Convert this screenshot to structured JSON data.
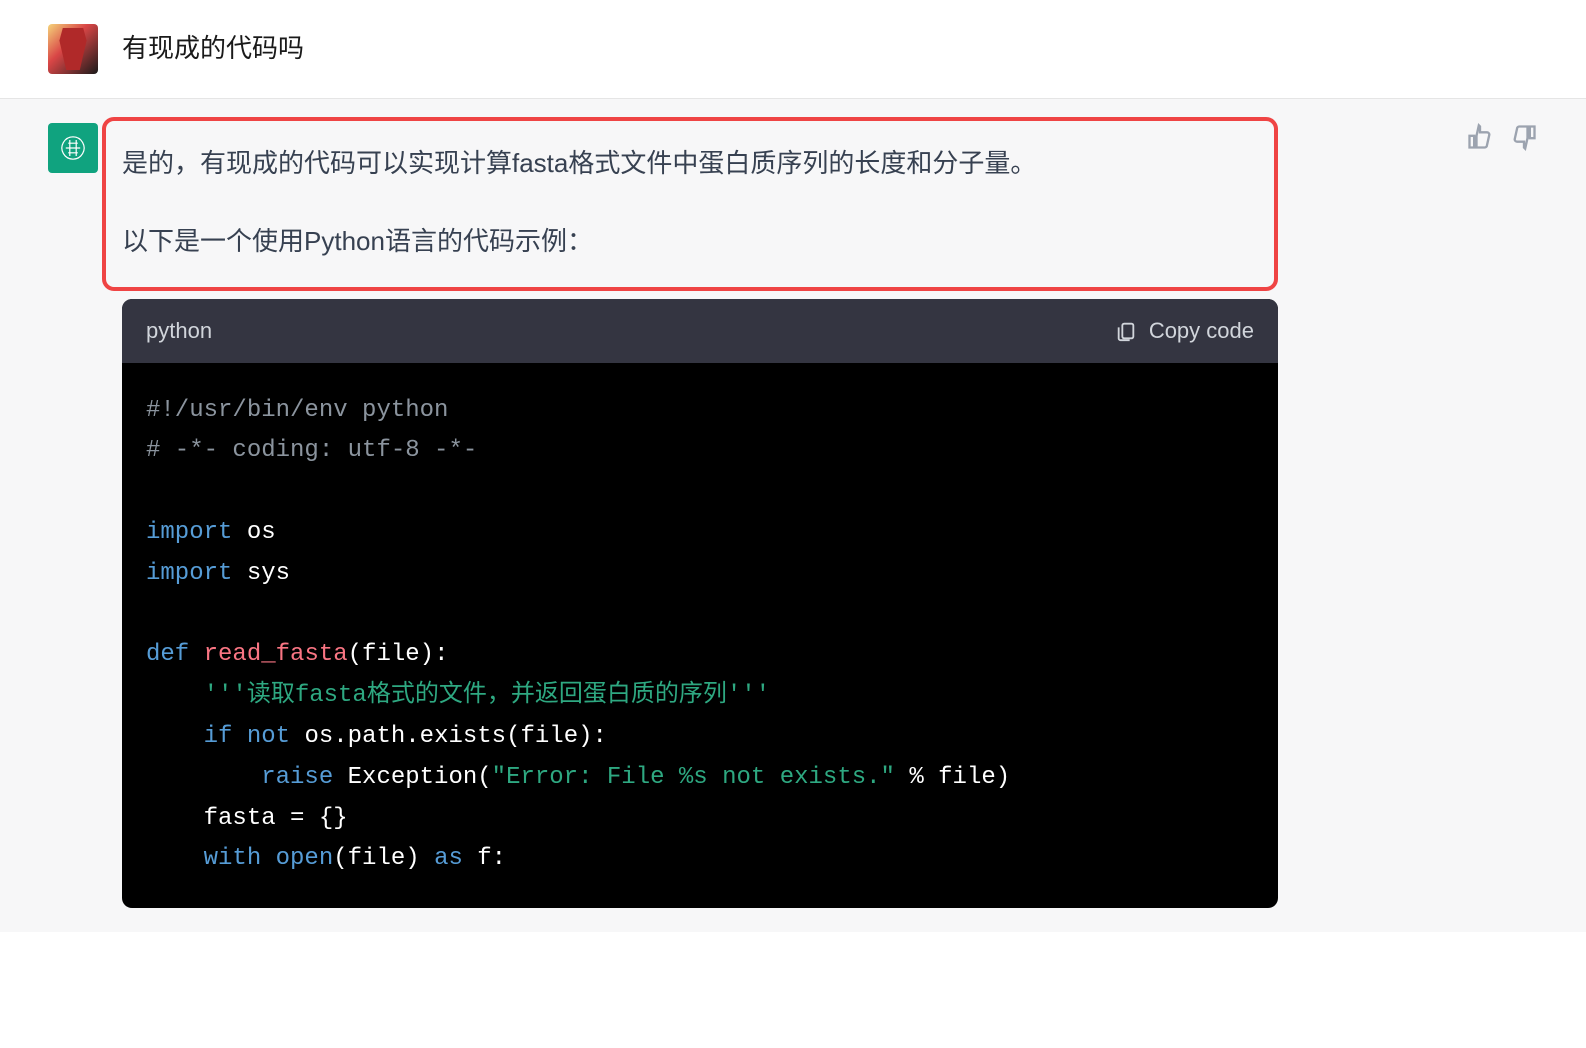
{
  "user": {
    "message": "有现成的代码吗"
  },
  "assistant": {
    "paragraph1": "是的，有现成的代码可以实现计算fasta格式文件中蛋白质序列的长度和分子量。",
    "paragraph2": "以下是一个使用Python语言的代码示例："
  },
  "code": {
    "language": "python",
    "copy_label": "Copy code",
    "lines": {
      "shebang": "#!/usr/bin/env python",
      "coding": "# -*- coding: utf-8 -*-",
      "import1_kw": "import",
      "import1_mod": "os",
      "import2_kw": "import",
      "import2_mod": "sys",
      "def_kw": "def",
      "def_name": "read_fasta",
      "def_sig_tail": "(file):",
      "docstring": "'''读取fasta格式的文件，并返回蛋白质的序列'''",
      "if_kw": "if",
      "not_kw": "not",
      "if_expr": "os.path.exists(file):",
      "raise_kw": "raise",
      "raise_call_head": "Exception(",
      "raise_str": "\"Error: File %s not exists.\"",
      "raise_tail": " % file)",
      "fasta_assign": "fasta = {}",
      "with_kw": "with",
      "open_kw": "open",
      "with_mid": "(file) ",
      "as_kw": "as",
      "with_tail": " f:"
    }
  }
}
